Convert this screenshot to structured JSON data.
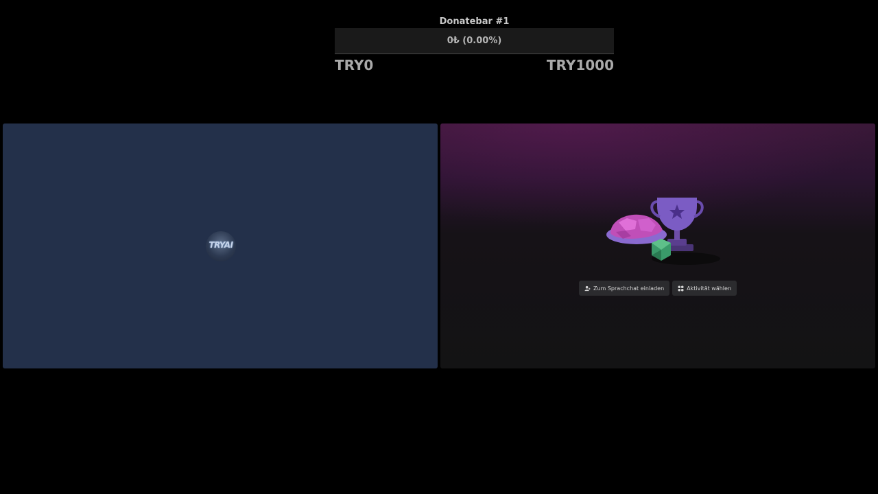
{
  "donatebar": {
    "title": "Donatebar #1",
    "value_text": "0₺ (0.00%)",
    "progress_fraction": 0,
    "min_label": "TRY0",
    "max_label": "TRY1000"
  },
  "left_tile": {
    "avatar_text": "TRYAI",
    "background": "#23304a"
  },
  "right_tile": {
    "invite_button": "Zum Sprachchat einladen",
    "activity_button": "Aktivität wählen",
    "icons": {
      "invite": "add-person-icon",
      "activity": "activity-grid-icon"
    }
  },
  "colors": {
    "page_background": "#000000",
    "accent_purple": "#8a4fc0",
    "gem_green": "#3a9a6a"
  }
}
